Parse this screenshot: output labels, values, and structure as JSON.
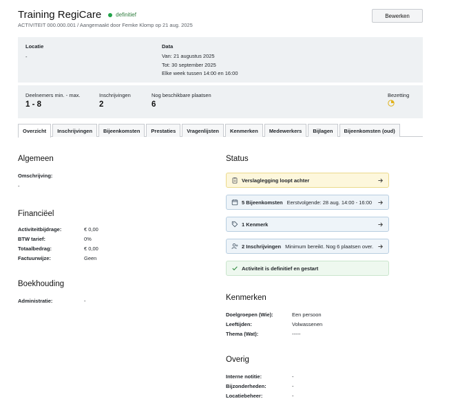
{
  "header": {
    "title": "Training RegiCare",
    "status": "definitief",
    "subtitle": "ACTIVITEIT 000.000.001 / Aangemaakt door Femke Klomp op 21 aug. 2025",
    "edit_label": "Bewerken"
  },
  "info": {
    "locatie_label": "Locatie",
    "locatie_value": "-",
    "data_label": "Data",
    "data_van": "Van: 21 augustus 2025",
    "data_tot": "Tot: 30 september 2025",
    "data_week": "Elke week tussen 14:00 en 16:00"
  },
  "stats": {
    "deelnemers_label": "Deelnemers min. - max.",
    "deelnemers_value": "1 - 8",
    "inschrijvingen_label": "Inschrijvingen",
    "inschrijvingen_value": "2",
    "plaatsen_label": "Nog beschikbare plaatsen",
    "plaatsen_value": "6",
    "bezetting_label": "Bezetting",
    "bezetting_fraction": 0.25
  },
  "tabs": [
    "Overzicht",
    "Inschrijvingen",
    "Bijeenkomsten",
    "Prestaties",
    "Vragenlijsten",
    "Kenmerken",
    "Medewerkers",
    "Bijlagen",
    "Bijeenkomsten (oud)"
  ],
  "algemeen": {
    "title": "Algemeen",
    "omschrijving_label": "Omschrijving:",
    "omschrijving_value": "-"
  },
  "financieel": {
    "title": "Financiëel",
    "rows": [
      {
        "label": "Activiteitbijdrage:",
        "value": "€ 0,00"
      },
      {
        "label": "BTW tarief:",
        "value": "0%"
      },
      {
        "label": "Totaalbedrag:",
        "value": "€ 0,00"
      },
      {
        "label": "Factuurwijze:",
        "value": "Geen"
      }
    ]
  },
  "boekhouding": {
    "title": "Boekhouding",
    "rows": [
      {
        "label": "Administratie:",
        "value": "-"
      }
    ]
  },
  "status": {
    "title": "Status",
    "items": [
      {
        "title": "Verslaglegging loopt achter",
        "sub": "",
        "icon": "clipboard-icon"
      },
      {
        "title": "5 Bijeenkomsten",
        "sub": "Eerstvolgende: 28 aug. 14:00 - 16:00",
        "icon": "calendar-icon"
      },
      {
        "title": "1 Kenmerk",
        "sub": "",
        "icon": "tag-icon"
      },
      {
        "title": "2 Inschrijvingen",
        "sub": "Minimum bereikt. Nog 6 plaatsen over.",
        "icon": "user-add-icon"
      },
      {
        "title": "Activiteit is definitief en gestart",
        "sub": "",
        "icon": "check-icon"
      }
    ]
  },
  "kenmerken": {
    "title": "Kenmerken",
    "rows": [
      {
        "label": "Doelgroepen (Wie):",
        "value": "Een persoon"
      },
      {
        "label": "Leeftijden:",
        "value": "Volwassenen"
      },
      {
        "label": "Thema (Wat):",
        "value": "-----"
      }
    ]
  },
  "overig": {
    "title": "Overig",
    "rows": [
      {
        "label": "Interne notitie:",
        "value": "-"
      },
      {
        "label": "Bijzonderheden:",
        "value": "-"
      },
      {
        "label": "Locatiebeheer:",
        "value": "-"
      }
    ]
  },
  "colors": {
    "status_green": "#22a34a",
    "warning_bg": "#fdf7dc",
    "info_bg": "#eef4f9",
    "success_bg": "#eef8ef",
    "panel_bg": "#eef1f3"
  }
}
